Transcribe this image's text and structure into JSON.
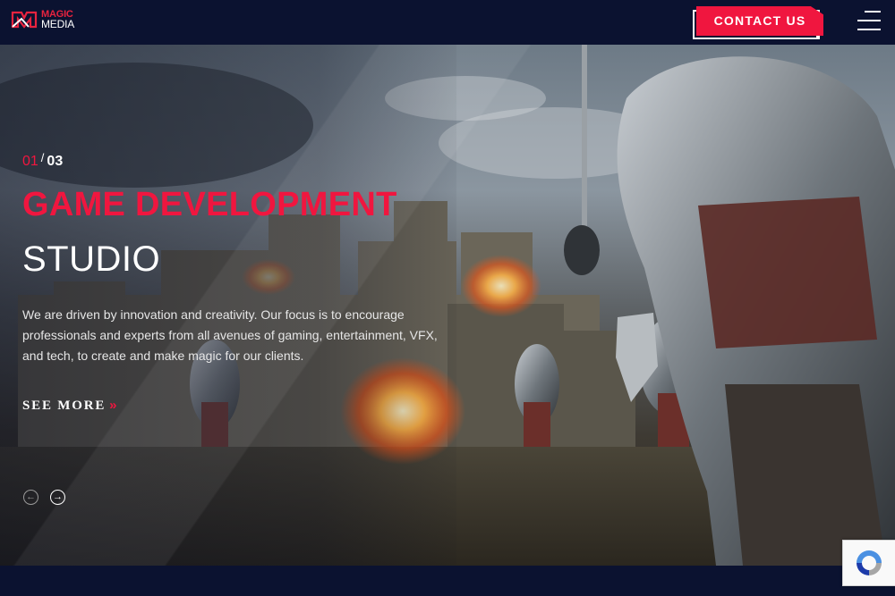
{
  "brand": {
    "line1": "MAGIC",
    "line2": "MEDIA"
  },
  "header": {
    "contact_label": "CONTACT US"
  },
  "slider": {
    "current": "01",
    "separator": "/",
    "total": "03",
    "title_line1": "GAME DEVELOPMENT",
    "title_line2": "STUDIO",
    "description": "We are driven by innovation and creativity. Our focus is to encourage professionals and experts from all avenues of gaming, entertainment, VFX, and tech, to create and make magic for our clients.",
    "cta_label": "SEE MORE",
    "cta_arrow": "»",
    "prev_icon": "←",
    "next_icon": "→"
  },
  "colors": {
    "accent": "#f0163f",
    "navy": "#0b1230"
  },
  "icons": [
    "logo-icon",
    "menu-icon",
    "arrow-left-icon",
    "arrow-right-icon",
    "recaptcha-icon"
  ]
}
